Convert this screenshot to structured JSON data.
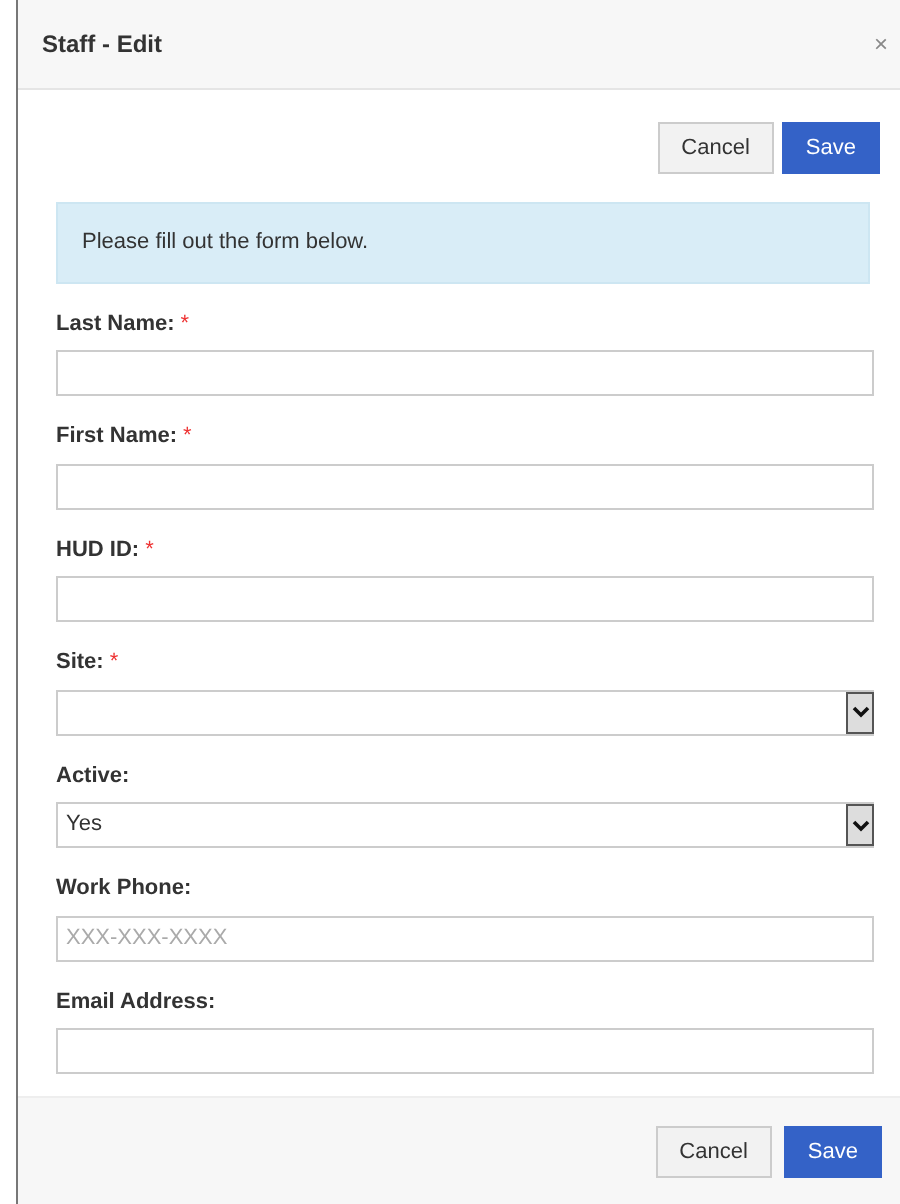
{
  "modal": {
    "title": "Staff - Edit",
    "close": "×"
  },
  "top_buttons": [
    {
      "label": "Cancel",
      "kind": "secondary"
    },
    {
      "label": "Save",
      "kind": "primary"
    }
  ],
  "alert": "Please fill out the form below.",
  "fields": [
    {
      "label": "Last Name:",
      "required": true,
      "kind": "text"
    },
    {
      "label": "First Name:",
      "required": true,
      "kind": "text"
    },
    {
      "label": "HUD ID:",
      "required": true,
      "kind": "text"
    },
    {
      "label": "Site:",
      "required": true,
      "kind": "select"
    },
    {
      "label": "Active:",
      "required": false,
      "kind": "select",
      "value": "Yes"
    },
    {
      "label": "Work Phone:",
      "required": false,
      "kind": "text",
      "placeholder": "XXX-XXX-XXXX"
    },
    {
      "label": "Email Address:",
      "required": false,
      "kind": "text"
    }
  ],
  "required_mark": "*",
  "footer_buttons": [
    {
      "label": "Cancel",
      "kind": "secondary"
    },
    {
      "label": "Save",
      "kind": "primary"
    }
  ]
}
